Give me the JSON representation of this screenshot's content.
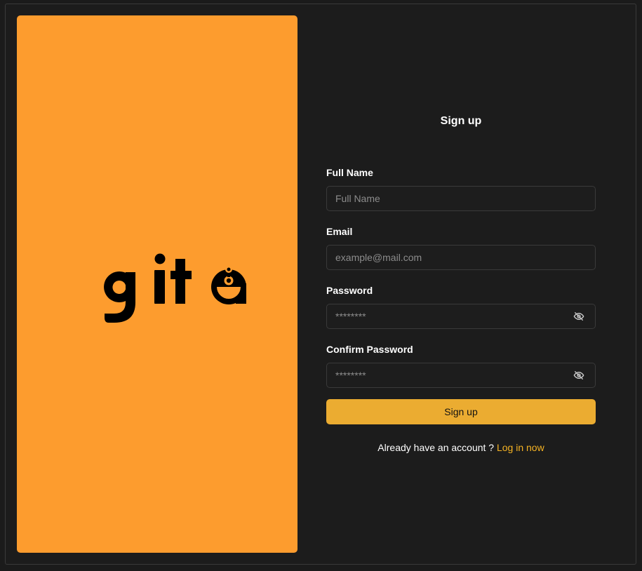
{
  "brand": {
    "logo_text": "gita",
    "panel_color": "#fd9c2e"
  },
  "form": {
    "title": "Sign up",
    "full_name": {
      "label": "Full Name",
      "placeholder": "Full Name",
      "value": ""
    },
    "email": {
      "label": "Email",
      "placeholder": "example@mail.com",
      "value": ""
    },
    "password": {
      "label": "Password",
      "placeholder": "********",
      "value": "",
      "toggle_icon": "eye-off-icon"
    },
    "confirm_password": {
      "label": "Confirm Password",
      "placeholder": "********",
      "value": "",
      "toggle_icon": "eye-off-icon"
    },
    "submit_label": "Sign up",
    "footer_text": "Already have an account ?",
    "login_link": "Log in now"
  },
  "colors": {
    "background": "#1c1c1c",
    "accent": "#ebac31",
    "link": "#f5b324"
  }
}
